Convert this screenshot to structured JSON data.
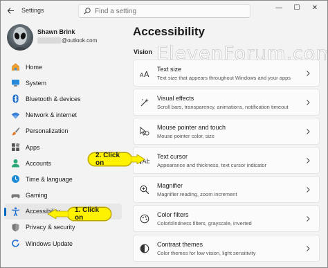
{
  "window": {
    "title": "Settings",
    "controls": {
      "minimize": "—",
      "maximize": "☐",
      "close": "✕"
    }
  },
  "search": {
    "placeholder": "Find a setting"
  },
  "profile": {
    "name": "Shawn Brink",
    "email_suffix": "@outlook.com"
  },
  "sidebar": {
    "items": [
      {
        "label": "Home",
        "icon": "home-icon"
      },
      {
        "label": "System",
        "icon": "system-icon"
      },
      {
        "label": "Bluetooth & devices",
        "icon": "bluetooth-icon"
      },
      {
        "label": "Network & internet",
        "icon": "wifi-icon"
      },
      {
        "label": "Personalization",
        "icon": "brush-icon"
      },
      {
        "label": "Apps",
        "icon": "apps-icon"
      },
      {
        "label": "Accounts",
        "icon": "accounts-icon"
      },
      {
        "label": "Time & language",
        "icon": "time-language-icon"
      },
      {
        "label": "Gaming",
        "icon": "gaming-icon"
      },
      {
        "label": "Accessibility",
        "icon": "accessibility-icon",
        "selected": true
      },
      {
        "label": "Privacy & security",
        "icon": "shield-icon"
      },
      {
        "label": "Windows Update",
        "icon": "windows-update-icon"
      }
    ]
  },
  "main": {
    "title": "Accessibility",
    "section": "Vision",
    "watermark": "ElevenForum.com",
    "settings": [
      {
        "title": "Text size",
        "description": "Text size that appears throughout Windows and your apps",
        "icon": "text-size-icon"
      },
      {
        "title": "Visual effects",
        "description": "Scroll bars, transparency, animations, notification timeout",
        "icon": "visual-effects-icon"
      },
      {
        "title": "Mouse pointer and touch",
        "description": "Mouse pointer color, size",
        "icon": "mouse-pointer-icon"
      },
      {
        "title": "Text cursor",
        "description": "Appearance and thickness, text cursor indicator",
        "icon": "text-cursor-icon"
      },
      {
        "title": "Magnifier",
        "description": "Magnifier reading, zoom increment",
        "icon": "magnifier-icon"
      },
      {
        "title": "Color filters",
        "description": "Colorblindness filters, grayscale, inverted",
        "icon": "color-filters-icon"
      },
      {
        "title": "Contrast themes",
        "description": "Color themes for low vision, light sensitivity",
        "icon": "contrast-themes-icon"
      }
    ]
  },
  "callouts": {
    "step1": "1. Click on",
    "step2": "2. Click on",
    "color": "#fff200"
  },
  "colors": {
    "accent": "#0067c0",
    "background": "#f3f3f3",
    "card": "#fbfbfb"
  }
}
